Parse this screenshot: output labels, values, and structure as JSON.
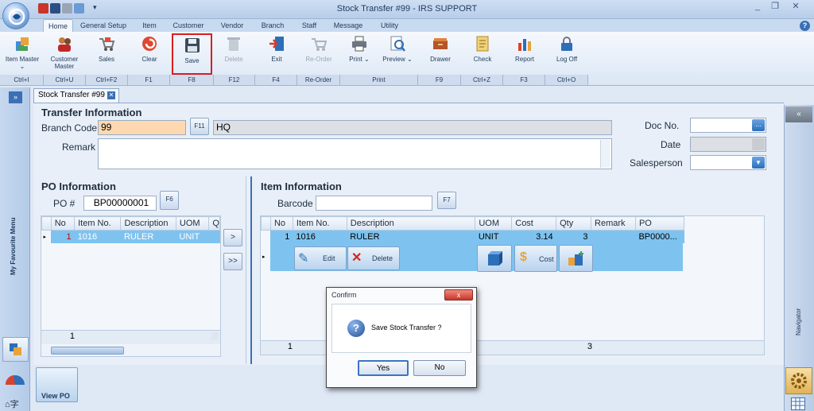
{
  "window": {
    "title": "Stock Transfer #99 - IRS SUPPORT"
  },
  "menu": {
    "tabs": [
      "Home",
      "General Setup",
      "Item",
      "Customer",
      "Vendor",
      "Branch",
      "Staff",
      "Message",
      "Utility"
    ]
  },
  "ribbon": {
    "buttons": [
      {
        "label": "Item Master",
        "shortcut": "Ctrl+I"
      },
      {
        "label": "Customer Master",
        "shortcut": "Ctrl+U"
      },
      {
        "label": "Sales",
        "shortcut": "Ctrl+F2"
      },
      {
        "label": "Clear",
        "shortcut": "F1"
      },
      {
        "label": "Save",
        "shortcut": "F8"
      },
      {
        "label": "Delete",
        "shortcut": "F12"
      },
      {
        "label": "Exit",
        "shortcut": "F4"
      },
      {
        "label": "Re-Order",
        "shortcut": "Re-Order"
      },
      {
        "label": "Print",
        "shortcut": "Print"
      },
      {
        "label": "Preview",
        "shortcut": ""
      },
      {
        "label": "Drawer",
        "shortcut": "F9"
      },
      {
        "label": "Check",
        "shortcut": "Ctrl+Z"
      },
      {
        "label": "Report",
        "shortcut": "F3"
      },
      {
        "label": "Log Off",
        "shortcut": "Ctrl+O"
      }
    ]
  },
  "doc_tab": {
    "label": "Stock Transfer #99"
  },
  "sidebar": {
    "favourite_menu": "My Favourite Menu",
    "view_po": "View PO"
  },
  "navigator": {
    "label": "Navigator"
  },
  "transfer": {
    "heading": "Transfer Information",
    "branch_code_label": "Branch Code",
    "branch_code": "99",
    "branch_lookup": "F11",
    "branch_name": "HQ",
    "remark_label": "Remark",
    "remark": "",
    "doc_no_label": "Doc No.",
    "doc_no_btn": "...",
    "date_label": "Date",
    "salesperson_label": "Salesperson"
  },
  "po": {
    "heading": "PO Information",
    "po_label": "PO #",
    "po_number": "BP00000001",
    "po_lookup": "F6",
    "columns": [
      "No",
      "Item No.",
      "Description",
      "UOM",
      "Q"
    ],
    "rows": [
      {
        "no": "1",
        "item": "1016",
        "desc": "RULER",
        "uom": "UNIT"
      }
    ],
    "footer_count": "1",
    "move_one": ">",
    "move_all": ">>"
  },
  "items": {
    "heading": "Item Information",
    "barcode_label": "Barcode",
    "barcode": "",
    "barcode_lookup": "F7",
    "columns": [
      "No",
      "Item No.",
      "Description",
      "UOM",
      "Cost",
      "Qty",
      "Remark",
      "PO"
    ],
    "rows": [
      {
        "no": "1",
        "item": "1016",
        "desc": "RULER",
        "uom": "UNIT",
        "cost": "3.14",
        "qty": "3",
        "remark": "",
        "po": "BP0000..."
      }
    ],
    "edit": "Edit",
    "delete": "Delete",
    "cost_btn": "Cost",
    "footer_count": "1",
    "footer_qty": "3"
  },
  "dialog": {
    "title": "Confirm",
    "message": "Save Stock Transfer ?",
    "yes": "Yes",
    "no": "No",
    "close": "x"
  },
  "colors": {
    "accent": "#3b6fb6",
    "highlight": "#7ec3f0",
    "branch_field": "#fdd8b0"
  }
}
